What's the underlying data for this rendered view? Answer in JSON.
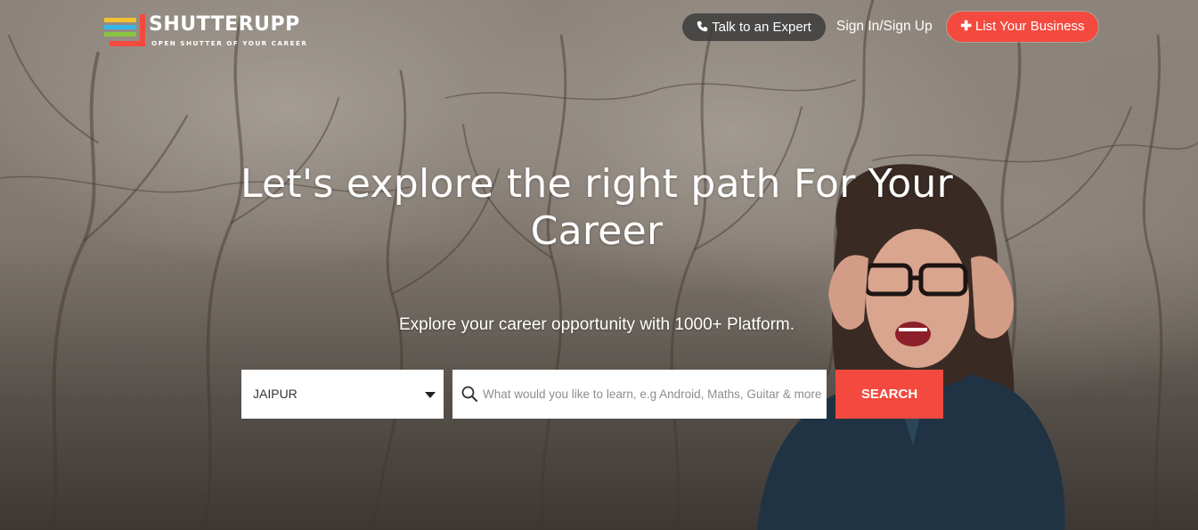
{
  "brand": {
    "title": "SHUTTERUPP",
    "tagline": "OPEN SHUTTER OF YOUR CAREER",
    "colors": [
      "#f2c230",
      "#35b6e8",
      "#f4493e",
      "#8bc53f"
    ]
  },
  "nav": {
    "expert_label": "Talk to an Expert",
    "expert_icon": "phone-icon",
    "signin_label": "Sign In/Sign Up",
    "list_label": "List Your Business",
    "list_icon": "plus-icon"
  },
  "hero": {
    "headline": "Let's explore the right path For Your Career",
    "subheadline": "Explore your career opportunity with 1000+ Platform."
  },
  "search": {
    "city_value": "JAIPUR",
    "placeholder": "What would you like to learn, e.g Android, Maths, Guitar & more",
    "button_label": "SEARCH",
    "icon": "search-icon"
  },
  "colors": {
    "accent": "#f4493e",
    "text_light": "#ffffff"
  }
}
